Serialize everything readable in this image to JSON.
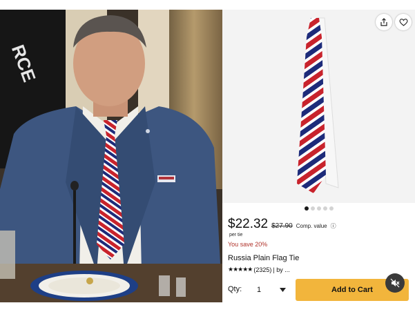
{
  "photo": {
    "flag_text": "RCE"
  },
  "product": {
    "price": "$22.32",
    "old_price": "$27.90",
    "comp_value": "Comp. value",
    "info_icon": "info-icon",
    "per_tie": "per tie",
    "savings": "You save 20%",
    "title": "Russia Plain Flag Tie",
    "stars": "★★★★★",
    "rating_count": "(2325)",
    "by_text": "| by ...",
    "qty_label": "Qty:",
    "qty_value": "1",
    "add_to_cart": "Add to Cart",
    "carousel_dots": 5,
    "carousel_active": 1
  },
  "icons": {
    "share": "share-icon",
    "heart": "heart-icon",
    "mute": "mute-icon",
    "dropdown": "chevron-down-icon"
  },
  "colors": {
    "accent_button": "#f2b53c",
    "savings_text": "#b0322a",
    "tie_red": "#c8232c",
    "tie_blue": "#1d2b7a",
    "tie_white": "#ffffff"
  }
}
